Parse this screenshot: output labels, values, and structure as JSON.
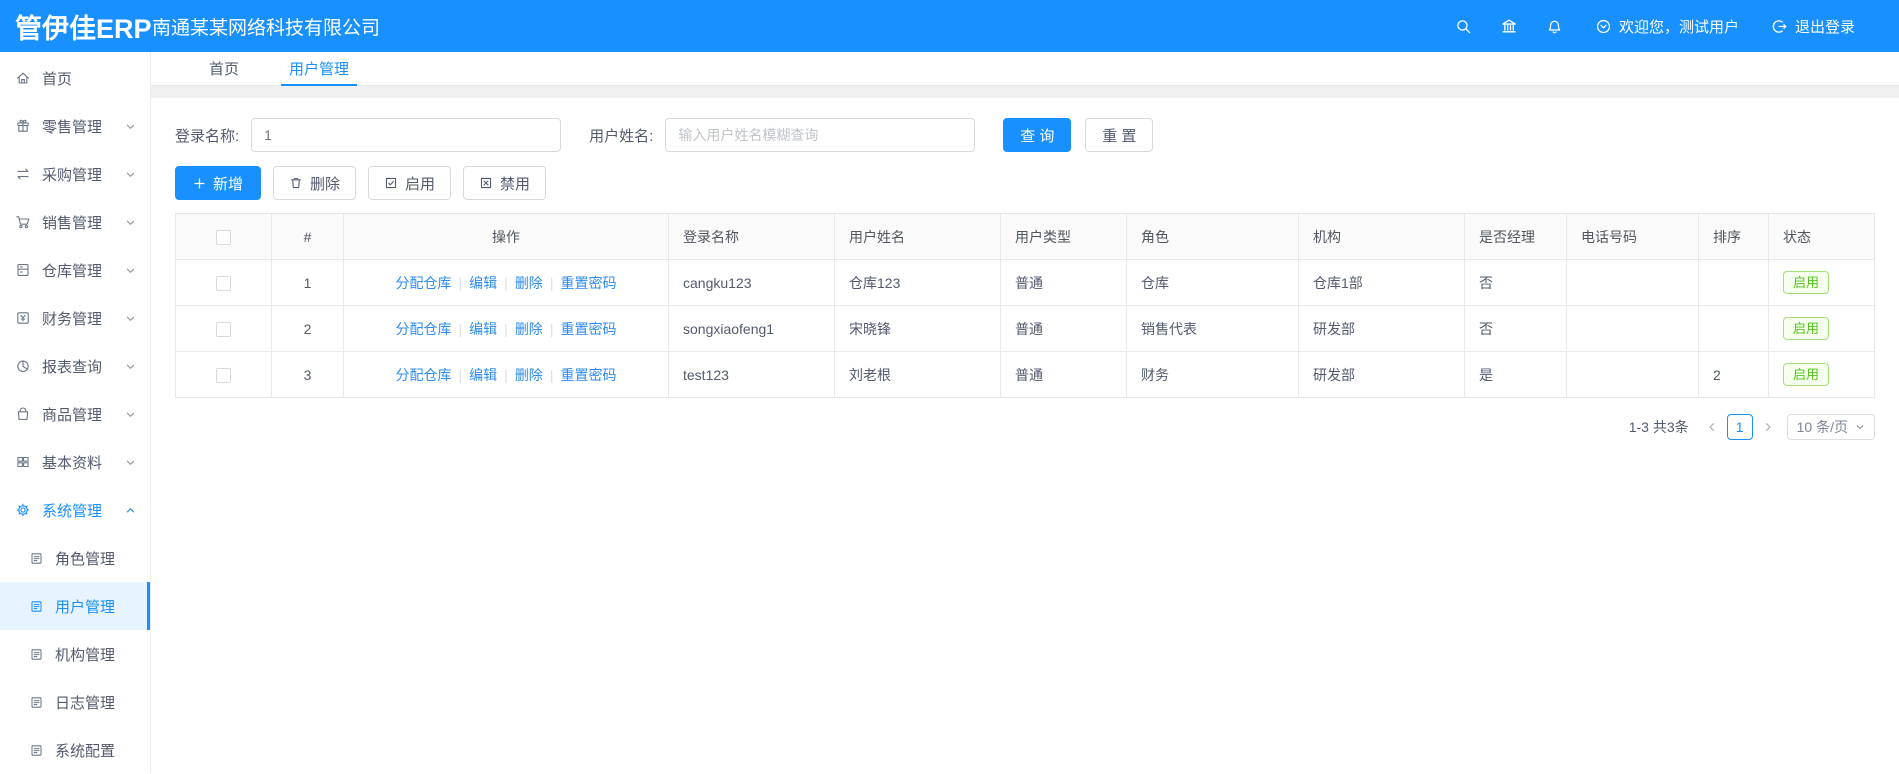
{
  "header": {
    "logo": "管伊佳ERP",
    "company": "南通某某网络科技有限公司",
    "icons": [
      "search-icon",
      "bank-icon",
      "bell-icon"
    ],
    "welcome": "欢迎您，测试用户",
    "logout": "退出登录"
  },
  "sidebar": {
    "items": [
      {
        "label": "首页",
        "icon": "home-icon",
        "expandable": false
      },
      {
        "label": "零售管理",
        "icon": "gift-icon",
        "expandable": true
      },
      {
        "label": "采购管理",
        "icon": "swap-icon",
        "expandable": true
      },
      {
        "label": "销售管理",
        "icon": "cart-icon",
        "expandable": true
      },
      {
        "label": "仓库管理",
        "icon": "cabinet-icon",
        "expandable": true
      },
      {
        "label": "财务管理",
        "icon": "finance-icon",
        "expandable": true
      },
      {
        "label": "报表查询",
        "icon": "pie-icon",
        "expandable": true
      },
      {
        "label": "商品管理",
        "icon": "bag-icon",
        "expandable": true
      },
      {
        "label": "基本资料",
        "icon": "grid-icon",
        "expandable": true
      },
      {
        "label": "系统管理",
        "icon": "gear-icon",
        "expandable": true,
        "expanded": true,
        "active": true
      }
    ],
    "sub_items": [
      {
        "label": "角色管理",
        "icon": "doc-icon"
      },
      {
        "label": "用户管理",
        "icon": "doc-icon",
        "active": true
      },
      {
        "label": "机构管理",
        "icon": "doc-icon"
      },
      {
        "label": "日志管理",
        "icon": "doc-icon"
      },
      {
        "label": "系统配置",
        "icon": "doc-icon"
      }
    ]
  },
  "tabs": [
    {
      "label": "首页",
      "active": false
    },
    {
      "label": "用户管理",
      "active": true
    }
  ],
  "search": {
    "login_label": "登录名称:",
    "login_value": "1",
    "name_label": "用户姓名:",
    "name_placeholder": "输入用户姓名模糊查询",
    "query_label": "查 询",
    "reset_label": "重 置"
  },
  "toolbar": {
    "add_label": "新增",
    "delete_label": "删除",
    "enable_label": "启用",
    "disable_label": "禁用"
  },
  "table": {
    "headers": [
      "#",
      "操作",
      "登录名称",
      "用户姓名",
      "用户类型",
      "角色",
      "机构",
      "是否经理",
      "电话号码",
      "排序",
      "状态"
    ],
    "action_links": [
      "分配仓库",
      "编辑",
      "删除",
      "重置密码"
    ],
    "rows": [
      {
        "index": "1",
        "login": "cangku123",
        "name": "仓库123",
        "type": "普通",
        "role": "仓库",
        "org": "仓库1部",
        "manager": "否",
        "phone": "",
        "sort": "",
        "status": "启用"
      },
      {
        "index": "2",
        "login": "songxiaofeng1",
        "name": "宋晓锋",
        "type": "普通",
        "role": "销售代表",
        "org": "研发部",
        "manager": "否",
        "phone": "",
        "sort": "",
        "status": "启用"
      },
      {
        "index": "3",
        "login": "test123",
        "name": "刘老根",
        "type": "普通",
        "role": "财务",
        "org": "研发部",
        "manager": "是",
        "phone": "",
        "sort": "2",
        "status": "启用"
      }
    ]
  },
  "pagination": {
    "total": "1-3 共3条",
    "page": "1",
    "page_size": "10 条/页"
  },
  "colors": {
    "primary": "#1890ff",
    "success": "#52c41a",
    "success_border": "#a4de7c",
    "sidebar_active_bg": "#e7f4ff",
    "table_border": "#e9e9e9"
  }
}
